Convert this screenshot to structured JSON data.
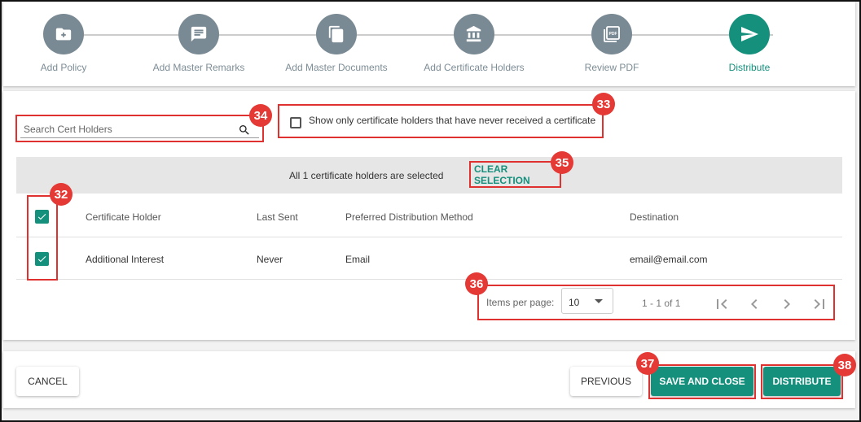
{
  "stepper": {
    "steps": [
      {
        "label": "Add Policy",
        "icon": "folder-plus-icon"
      },
      {
        "label": "Add Master Remarks",
        "icon": "comment-icon"
      },
      {
        "label": "Add Master Documents",
        "icon": "documents-icon"
      },
      {
        "label": "Add Certificate Holders",
        "icon": "bank-icon"
      },
      {
        "label": "Review PDF",
        "icon": "pdf-icon"
      },
      {
        "label": "Distribute",
        "icon": "send-icon",
        "active": true
      }
    ]
  },
  "search": {
    "placeholder": "Search Cert Holders",
    "value": ""
  },
  "filter": {
    "label": "Show only certificate holders that have never received a certificate",
    "checked": false
  },
  "selection": {
    "text": "All 1 certificate holders are selected",
    "clear_label": "CLEAR SELECTION"
  },
  "table": {
    "headers": {
      "holder": "Certificate Holder",
      "last_sent": "Last Sent",
      "method": "Preferred Distribution Method",
      "destination": "Destination"
    },
    "rows": [
      {
        "holder": "Additional Interest",
        "last_sent": "Never",
        "method": "Email",
        "destination": "email@email.com",
        "selected": true
      }
    ]
  },
  "pagination": {
    "items_per_page_label": "Items per page:",
    "items_per_page": "10",
    "range": "1 - 1 of 1"
  },
  "footer": {
    "cancel": "CANCEL",
    "previous": "PREVIOUS",
    "save_close": "SAVE AND CLOSE",
    "distribute": "DISTRIBUTE"
  },
  "badges": {
    "b32": "32",
    "b33": "33",
    "b34": "34",
    "b35": "35",
    "b36": "36",
    "b37": "37",
    "b38": "38"
  },
  "colors": {
    "accent": "#15907d",
    "inactive_step": "#7a8a94",
    "annotation": "#e03131"
  }
}
